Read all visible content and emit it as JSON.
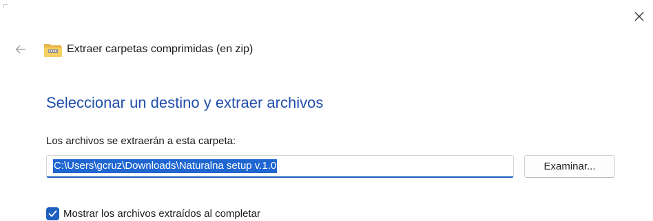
{
  "dialog": {
    "title": "Extraer carpetas comprimidas (en zip)",
    "heading": "Seleccionar un destino y extraer archivos"
  },
  "destination": {
    "label": "Los archivos se extraerán a esta carpeta:",
    "path": "C:\\Users\\gcruz\\Downloads\\Naturalna setup v.1.0",
    "browse_label": "Examinar..."
  },
  "options": {
    "show_extracted_label": "Mostrar los archivos extraídos al completar",
    "show_extracted_checked": true
  },
  "icons": {
    "close": "close-icon",
    "back": "back-arrow-icon",
    "folder": "zip-folder-icon",
    "check": "checkmark-icon"
  },
  "colors": {
    "accent": "#1f5fbf",
    "heading": "#1f4ea8",
    "selection": "#1f66d1"
  }
}
